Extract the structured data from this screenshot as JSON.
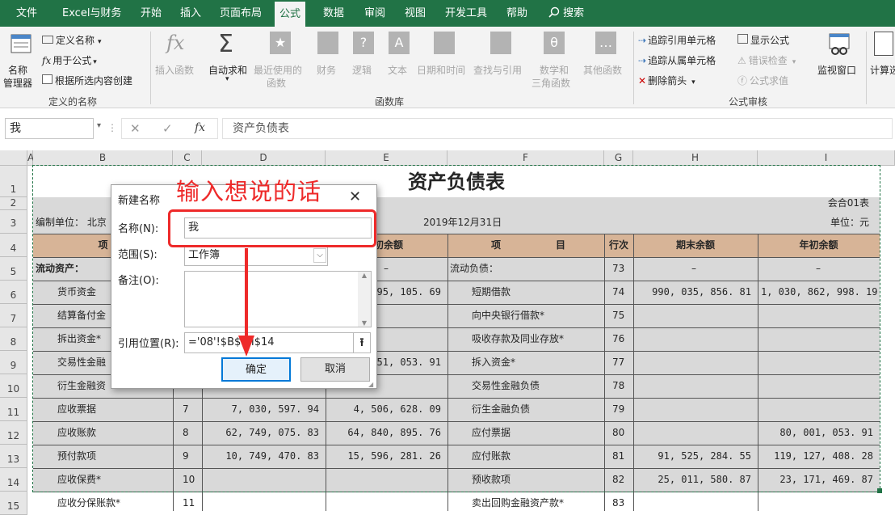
{
  "menu": {
    "tabs": [
      "文件",
      "Excel与财务",
      "开始",
      "插入",
      "页面布局",
      "公式",
      "数据",
      "审阅",
      "视图",
      "开发工具",
      "帮助"
    ],
    "active": "公式",
    "search": "搜索"
  },
  "ribbon": {
    "name_manager": [
      "名称",
      "管理器"
    ],
    "define_name": "定义名称",
    "use_in_formula": "用于公式",
    "create_from_selection": "根据所选内容创建",
    "group_defined_names": "定义的名称",
    "insert_function": "插入函数",
    "autosum": "自动求和",
    "recent": [
      "最近使用的",
      "函数"
    ],
    "financial": "财务",
    "logical": "逻辑",
    "text": "文本",
    "datetime": "日期和时间",
    "lookup": "查找与引用",
    "math": [
      "数学和",
      "三角函数"
    ],
    "other": "其他函数",
    "group_library": "函数库",
    "trace_precedents": "追踪引用单元格",
    "trace_dependents": "追踪从属单元格",
    "remove_arrows": "删除箭头",
    "show_formulas": "显示公式",
    "error_check": "错误检查",
    "evaluate": "公式求值",
    "group_auditing": "公式审核",
    "watch": "监视窗口",
    "calc": "计算选"
  },
  "formula_bar": {
    "name_box": "我",
    "formula": "资产负债表"
  },
  "sheet": {
    "columns": [
      "A",
      "B",
      "C",
      "D",
      "E",
      "F",
      "G",
      "H",
      "I"
    ],
    "rows": [
      "1",
      "2",
      "3",
      "4",
      "5",
      "6",
      "7",
      "8",
      "9",
      "10",
      "11",
      "12",
      "13",
      "14",
      "15"
    ],
    "title": "资产负债表",
    "form_no": "会合01表",
    "unit": "单位：元",
    "prepared_by": "编制单位：  北京",
    "date": "2019年12月31日",
    "headers": {
      "item_left": "项",
      "begin_left": "初余额",
      "item_right_a": "项",
      "item_right_b": "目",
      "line_no": "行次",
      "end_balance": "期末余额",
      "begin_balance": "年初余额"
    },
    "left_rows": [
      {
        "b": "流动资产：",
        "c": "",
        "d": "",
        "e": "–",
        "bold": true
      },
      {
        "b": "货币资金",
        "c": "",
        "d": "",
        "e": ", 295, 105. 69"
      },
      {
        "b": "结算备付金",
        "c": "",
        "d": "",
        "e": ""
      },
      {
        "b": "拆出资金*",
        "c": "",
        "d": "",
        "e": ""
      },
      {
        "b": "交易性金融",
        "c": "",
        "d": "",
        "e": "51, 053. 91"
      },
      {
        "b": "衍生金融资",
        "c": "",
        "d": "",
        "e": ""
      },
      {
        "b": "应收票据",
        "c": "7",
        "d": "7, 030, 597. 94",
        "e": "4, 506, 628. 09"
      },
      {
        "b": "应收账款",
        "c": "8",
        "d": "62, 749, 075. 83",
        "e": "64, 840, 895. 76"
      },
      {
        "b": "预付款项",
        "c": "9",
        "d": "10, 749, 470. 83",
        "e": "15, 596, 281. 26"
      },
      {
        "b": "应收保费*",
        "c": "10",
        "d": "",
        "e": ""
      },
      {
        "b": "应收分保账款*",
        "c": "11",
        "d": "",
        "e": ""
      }
    ],
    "right_rows": [
      {
        "f": "流动负债：",
        "g": "73",
        "h": "–",
        "i": "–",
        "bold": true
      },
      {
        "f": "短期借款",
        "g": "74",
        "h": "990, 035, 856. 81",
        "i": "1, 030, 862, 998. 19"
      },
      {
        "f": "向中央银行借款*",
        "g": "75",
        "h": "",
        "i": ""
      },
      {
        "f": "吸收存款及同业存放*",
        "g": "76",
        "h": "",
        "i": ""
      },
      {
        "f": "拆入资金*",
        "g": "77",
        "h": "",
        "i": ""
      },
      {
        "f": "交易性金融负债",
        "g": "78",
        "h": "",
        "i": ""
      },
      {
        "f": "衍生金融负债",
        "g": "79",
        "h": "",
        "i": ""
      },
      {
        "f": "应付票据",
        "g": "80",
        "h": "",
        "i": "80, 001, 053. 91"
      },
      {
        "f": "应付账款",
        "g": "81",
        "h": "91, 525, 284. 55",
        "i": "119, 127, 408. 28"
      },
      {
        "f": "预收款项",
        "g": "82",
        "h": "25, 011, 580. 87",
        "i": "23, 171, 469. 87"
      },
      {
        "f": "卖出回购金融资产款*",
        "g": "83",
        "h": "",
        "i": ""
      }
    ]
  },
  "dialog": {
    "title": "新建名称",
    "name_label": "名称(N):",
    "name_value": "我",
    "scope_label": "范围(S):",
    "scope_value": "工作簿",
    "comment_label": "备注(O):",
    "ref_label": "引用位置(R):",
    "ref_value": "='08'!$B$1:I$14",
    "ok": "确定",
    "cancel": "取消"
  },
  "annotation": "输入想说的话",
  "colors": {
    "excel_green": "#217346",
    "annot_red": "#ee2a2a",
    "header_tan": "#d7b497",
    "cell_grey": "#d9d9d9"
  }
}
